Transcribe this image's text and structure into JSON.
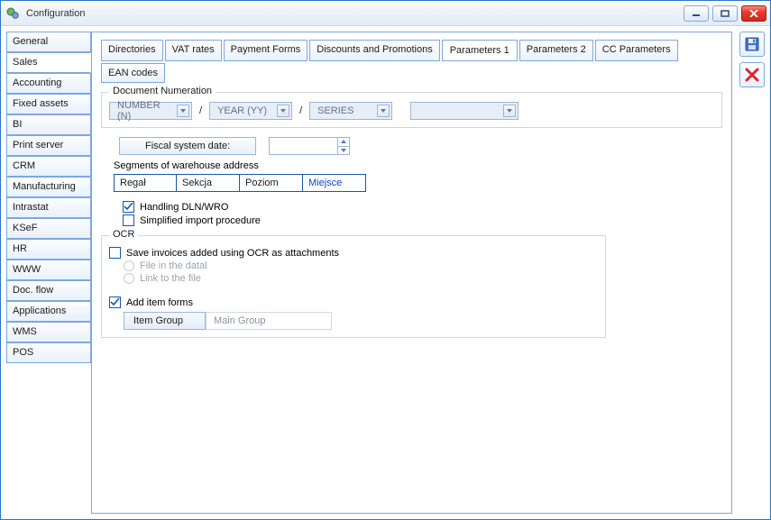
{
  "window": {
    "title": "Configuration"
  },
  "winbuttons": {
    "min": "minimize",
    "max": "maximize",
    "close": "close"
  },
  "sidebar": {
    "items": [
      {
        "label": "General"
      },
      {
        "label": "Sales"
      },
      {
        "label": "Accounting"
      },
      {
        "label": "Fixed assets"
      },
      {
        "label": "BI"
      },
      {
        "label": "Print server"
      },
      {
        "label": "CRM"
      },
      {
        "label": "Manufacturing"
      },
      {
        "label": "Intrastat"
      },
      {
        "label": "KSeF"
      },
      {
        "label": "HR"
      },
      {
        "label": "WWW"
      },
      {
        "label": "Doc. flow"
      },
      {
        "label": "Applications"
      },
      {
        "label": "WMS"
      },
      {
        "label": "POS"
      }
    ],
    "activeIndex": 1
  },
  "topTabs": {
    "items": [
      {
        "label": "Directories"
      },
      {
        "label": "VAT rates"
      },
      {
        "label": "Payment Forms"
      },
      {
        "label": "Discounts and Promotions"
      },
      {
        "label": "Parameters 1"
      },
      {
        "label": "Parameters 2"
      },
      {
        "label": "CC Parameters"
      },
      {
        "label": "EAN codes"
      }
    ],
    "activeIndex": 4
  },
  "docNum": {
    "legend": "Document Numeration",
    "parts": [
      "NUMBER (N)",
      "YEAR (YY)",
      "SERIES"
    ],
    "sep": "/",
    "extra": ""
  },
  "fiscal": {
    "label": "Fiscal system date:",
    "value": ""
  },
  "segments": {
    "legend": "Segments of warehouse address",
    "cells": [
      "Regał",
      "Sekcja",
      "Poziom",
      "Miejsce"
    ],
    "selectedIndex": 3
  },
  "checks": {
    "dln": {
      "label": "Handling DLN/WRO",
      "checked": true
    },
    "simp": {
      "label": "Simplified import procedure",
      "checked": false
    }
  },
  "ocr": {
    "legend": "OCR",
    "save": {
      "label": "Save invoices added using OCR as attachments",
      "checked": false
    },
    "rFile": {
      "label": "File in the datal"
    },
    "rLink": {
      "label": "Link to the file"
    },
    "add": {
      "label": "Add item forms",
      "checked": true
    },
    "ig": {
      "label": "Item Group",
      "value": "Main Group"
    }
  },
  "actions": {
    "save": "save-icon",
    "cancel": "cancel-icon"
  }
}
